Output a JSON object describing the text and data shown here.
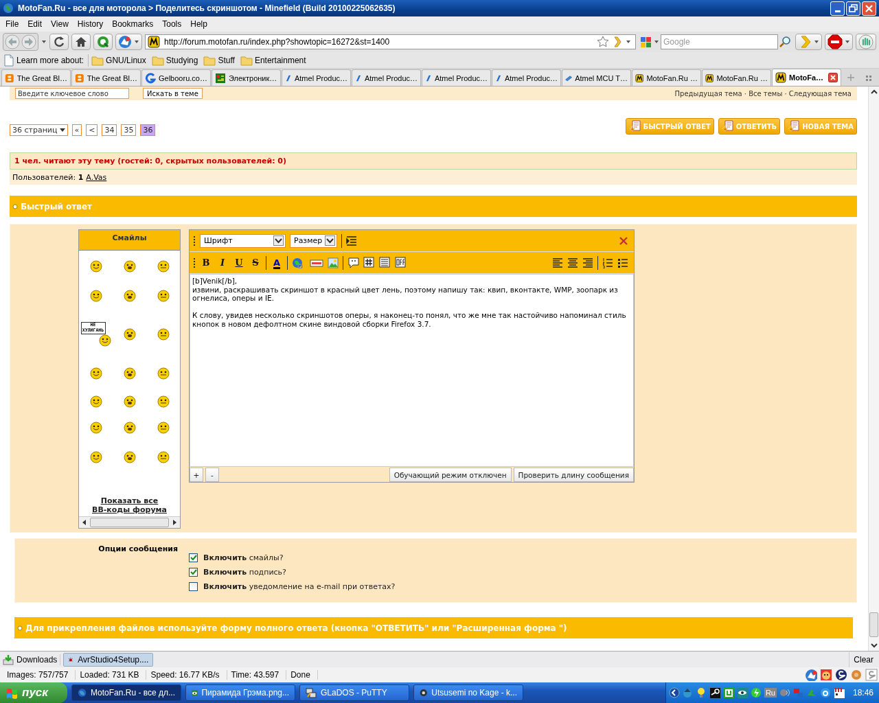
{
  "window": {
    "title": "MotoFan.Ru - все для моторола > Поделитесь скриншотом - Minefield (Build 20100225062635)"
  },
  "menu": [
    "File",
    "Edit",
    "View",
    "History",
    "Bookmarks",
    "Tools",
    "Help"
  ],
  "toolbar": {
    "url": "http://forum.motofan.ru/index.php?showtopic=16272&st=1400",
    "search_placeholder": "Google"
  },
  "bookmarks_bar": {
    "label": "Learn more about:",
    "folders": [
      "GNU/Linux",
      "Studying",
      "Stuff",
      "Entertainment"
    ]
  },
  "tabs": [
    {
      "label": "The Great Bl…",
      "kind": "blogger",
      "selected": false
    },
    {
      "label": "The Great Bl…",
      "kind": "blogger",
      "selected": false
    },
    {
      "label": "Gelbooru.co…",
      "kind": "letter-g",
      "selected": false
    },
    {
      "label": "Электроник…",
      "kind": "board",
      "selected": false
    },
    {
      "label": "Atmel Produc…",
      "kind": "atmel",
      "selected": false
    },
    {
      "label": "Atmel Produc…",
      "kind": "atmel",
      "selected": false
    },
    {
      "label": "Atmel Produc…",
      "kind": "atmel",
      "selected": false
    },
    {
      "label": "Atmel Produc…",
      "kind": "atmel",
      "selected": false
    },
    {
      "label": "Atmel MCU T…",
      "kind": "chip",
      "selected": false
    },
    {
      "label": "MotoFan.Ru …",
      "kind": "motofan",
      "selected": false
    },
    {
      "label": "MotoFan.Ru …",
      "kind": "motofan",
      "selected": false
    },
    {
      "label": "MotoFa…",
      "kind": "motofan",
      "selected": true
    }
  ],
  "forum": {
    "search": {
      "placeholder": "Введите ключевое слово",
      "button": "Искать в теме",
      "topic_nav": "Предыдущая тема · Все темы · Следующая тема"
    },
    "pages": [
      {
        "label": "36 страниц",
        "kind": "dropdown",
        "selected": false
      },
      {
        "label": "«",
        "kind": "nav",
        "selected": false
      },
      {
        "label": "<",
        "kind": "nav",
        "selected": false
      },
      {
        "label": "34",
        "kind": "page",
        "selected": false
      },
      {
        "label": "35",
        "kind": "page",
        "selected": false
      },
      {
        "label": "36",
        "kind": "page",
        "selected": true
      }
    ],
    "actions": [
      "БЫСТРЫЙ ОТВЕТ",
      "ОТВЕТИТЬ",
      "НОВАЯ ТЕМА"
    ],
    "online": {
      "text": "1 чел. читают эту тему (гостей: 0, скрытых пользователей: 0)",
      "users_label": "Пользователей: **1**",
      "users": [
        "A.Vas"
      ]
    },
    "quick_reply": {
      "title": "Быстрый ответ",
      "smileys": {
        "title": "Смайлы",
        "items": [
          {
            "kind": "face"
          },
          {
            "kind": "face"
          },
          {
            "kind": "face"
          },
          {
            "kind": "face"
          },
          {
            "kind": "face"
          },
          {
            "kind": "face"
          },
          {
            "kind": "sign",
            "sign": "НЕ ХУЛИГАНЬ"
          },
          {
            "kind": "face"
          },
          {
            "kind": "face"
          },
          {
            "kind": "face"
          },
          {
            "kind": "face"
          },
          {
            "kind": "face"
          },
          {
            "kind": "face"
          },
          {
            "kind": "face"
          },
          {
            "kind": "face"
          },
          {
            "kind": "face"
          },
          {
            "kind": "face"
          },
          {
            "kind": "face"
          },
          {
            "kind": "face"
          },
          {
            "kind": "face"
          },
          {
            "kind": "face"
          }
        ],
        "links": [
          "Показать все",
          "BB-коды форума"
        ]
      },
      "editor": {
        "font": "Шрифт",
        "size": "Размер",
        "format_buttons": [
          {
            "label": "B",
            "kind": "bold"
          },
          {
            "label": "I",
            "kind": "italic"
          },
          {
            "label": "U",
            "kind": "underline"
          },
          {
            "label": "S",
            "kind": "strike"
          },
          {
            "label": "A",
            "kind": "color"
          }
        ],
        "text": "[b]Venik[/b],\nизвини, раскрашивать скриншот в красный цвет лень, поэтому напишу так: квип, вконтакте, WMP, зоопарк из огнелиса, оперы и IE.\n\nК слову, увидев несколько скриншотов оперы, я наконец-то понял, что же мне так настойчиво напоминал стиль кнопок в новом дефолтном скине виндовой сборки Firefox 3.7.",
        "size_buttons": [
          "+",
          "-"
        ],
        "buttons": [
          "Обучающий режим отключен",
          "Проверить длину сообщения"
        ]
      }
    },
    "options": {
      "title": "Опции сообщения",
      "items": [
        {
          "text": "**Включить** смайлы?",
          "checked": true
        },
        {
          "text": "**Включить** подпись?",
          "checked": true
        },
        {
          "text": "**Включить** уведомление на e-mail при ответах?",
          "checked": false
        }
      ]
    },
    "attach_notice": "Для прикрепления файлов используйте форму полного ответа (кнопка \"ОТВЕТИТЬ\" или \"Расширенная форма \")"
  },
  "downloads": {
    "label": "Downloads",
    "items": [
      "AvrStudio4Setup...."
    ],
    "clear": "Clear"
  },
  "status_bar": [
    "Images: 757/757",
    "Loaded: 731 KB",
    "Speed: 16.77 KB/s",
    "Time: 43.597",
    "Done"
  ],
  "taskbar": {
    "start": "пуск",
    "tasks": [
      {
        "label": "MotoFan.Ru - все дл...",
        "kind": "browser",
        "selected": true
      },
      {
        "label": "Пирамида Грэма.png...",
        "kind": "viewer",
        "selected": false
      },
      {
        "label": "GLaDOS - PuTTY",
        "kind": "terminal",
        "selected": false
      },
      {
        "label": "Utsusemi no Kage - k...",
        "kind": "player",
        "selected": false
      }
    ],
    "language": "Ru",
    "clock": "18:46"
  }
}
